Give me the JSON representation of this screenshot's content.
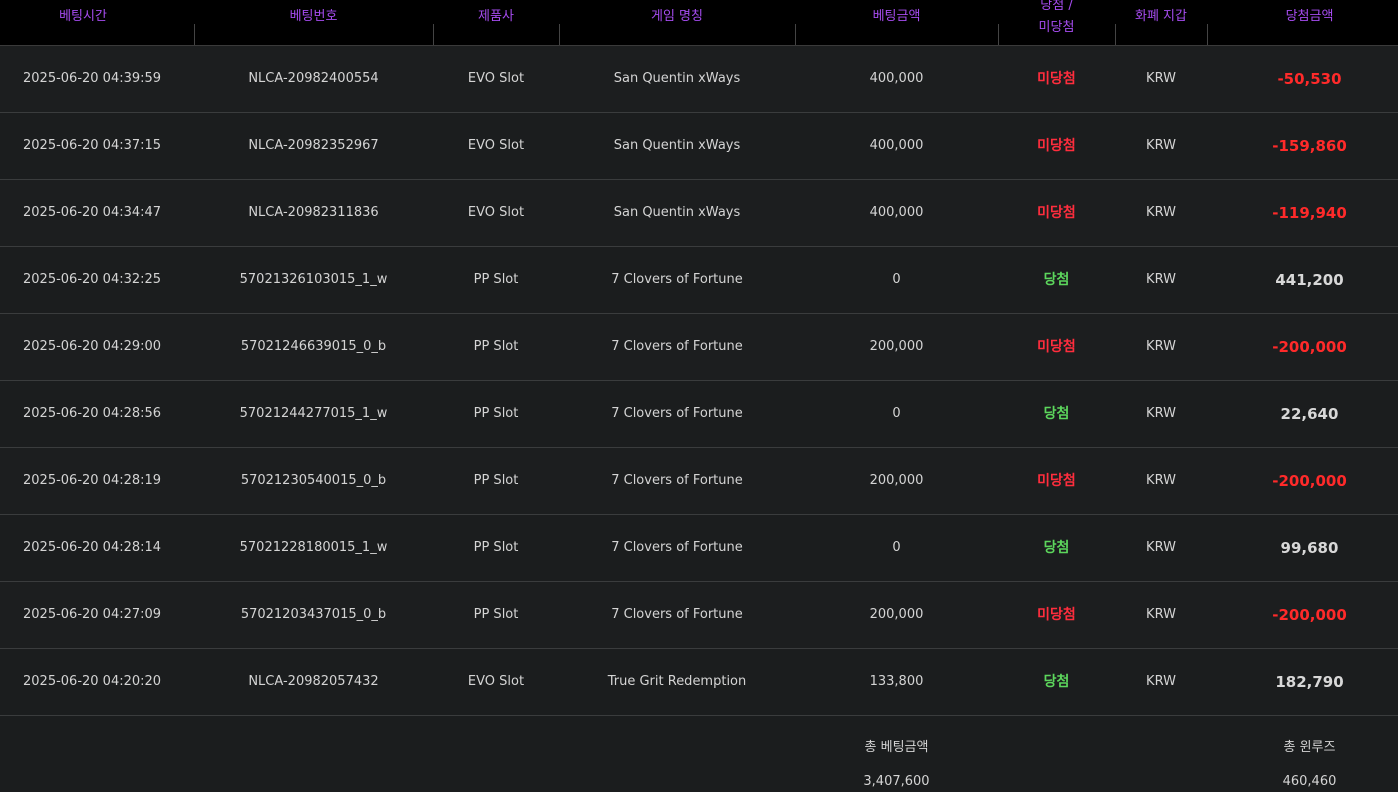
{
  "header": {
    "bet_time": "베팅시간",
    "bet_no": "베팅번호",
    "provider": "제품사",
    "game_name": "게임 명칭",
    "bet_amount": "베팅금액",
    "result_line1": "당첨 /",
    "result_line2": "미당첨",
    "currency": "화폐 지갑",
    "win_amount": "당첨금액"
  },
  "rows": [
    {
      "time": "2025-06-20 04:39:59",
      "id": "NLCA-20982400554",
      "provider": "EVO Slot",
      "game": "San Quentin xWays",
      "bet": "400,000",
      "result": "미당첨",
      "currency": "KRW",
      "win": "-50,530"
    },
    {
      "time": "2025-06-20 04:37:15",
      "id": "NLCA-20982352967",
      "provider": "EVO Slot",
      "game": "San Quentin xWays",
      "bet": "400,000",
      "result": "미당첨",
      "currency": "KRW",
      "win": "-159,860"
    },
    {
      "time": "2025-06-20 04:34:47",
      "id": "NLCA-20982311836",
      "provider": "EVO Slot",
      "game": "San Quentin xWays",
      "bet": "400,000",
      "result": "미당첨",
      "currency": "KRW",
      "win": "-119,940"
    },
    {
      "time": "2025-06-20 04:32:25",
      "id": "57021326103015_1_w",
      "provider": "PP Slot",
      "game": "7 Clovers of Fortune",
      "bet": "0",
      "result": "당첨",
      "currency": "KRW",
      "win": "441,200"
    },
    {
      "time": "2025-06-20 04:29:00",
      "id": "57021246639015_0_b",
      "provider": "PP Slot",
      "game": "7 Clovers of Fortune",
      "bet": "200,000",
      "result": "미당첨",
      "currency": "KRW",
      "win": "-200,000"
    },
    {
      "time": "2025-06-20 04:28:56",
      "id": "57021244277015_1_w",
      "provider": "PP Slot",
      "game": "7 Clovers of Fortune",
      "bet": "0",
      "result": "당첨",
      "currency": "KRW",
      "win": "22,640"
    },
    {
      "time": "2025-06-20 04:28:19",
      "id": "57021230540015_0_b",
      "provider": "PP Slot",
      "game": "7 Clovers of Fortune",
      "bet": "200,000",
      "result": "미당첨",
      "currency": "KRW",
      "win": "-200,000"
    },
    {
      "time": "2025-06-20 04:28:14",
      "id": "57021228180015_1_w",
      "provider": "PP Slot",
      "game": "7 Clovers of Fortune",
      "bet": "0",
      "result": "당첨",
      "currency": "KRW",
      "win": "99,680"
    },
    {
      "time": "2025-06-20 04:27:09",
      "id": "57021203437015_0_b",
      "provider": "PP Slot",
      "game": "7 Clovers of Fortune",
      "bet": "200,000",
      "result": "미당첨",
      "currency": "KRW",
      "win": "-200,000"
    },
    {
      "time": "2025-06-20 04:20:20",
      "id": "NLCA-20982057432",
      "provider": "EVO Slot",
      "game": "True Grit Redemption",
      "bet": "133,800",
      "result": "당첨",
      "currency": "KRW",
      "win": "182,790"
    }
  ],
  "footer": {
    "total_bet_label": "총 베팅금액",
    "total_bet_value": "3,407,600",
    "total_winloss_label": "총 윈루즈",
    "total_winloss_value": "460,460"
  },
  "colors": {
    "header_text": "#a64cf0",
    "lose_text": "#ff2d3d",
    "win_text": "#5cd65c",
    "negative_amount": "#ff2a2a"
  }
}
